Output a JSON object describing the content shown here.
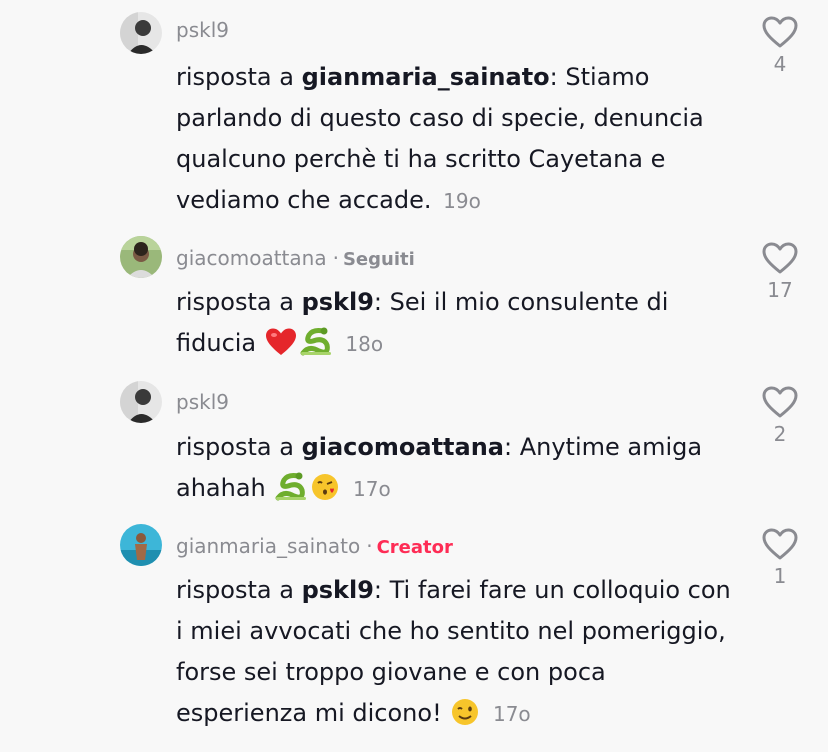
{
  "comments": [
    {
      "username": "pskl9",
      "badge": "",
      "reply_prefix": "risposta a",
      "reply_target": "gianmaria_sainato",
      "text": ": Stiamo parlando di questo caso di specie, denuncia qualcuno perchè ti ha scritto Cayetana e vediamo che accade.",
      "time": "19o",
      "likes": "4",
      "avatar_color": "#555555"
    },
    {
      "username": "giacomoattana",
      "badge": "Seguiti",
      "reply_prefix": "risposta a",
      "reply_target": "pskl9",
      "text": ": Sei il mio consulente di fiducia",
      "emojis": [
        "red-heart-emoji",
        "snake-emoji"
      ],
      "time": "18o",
      "likes": "17",
      "avatar_color": "#6b8f4e"
    },
    {
      "username": "pskl9",
      "badge": "",
      "reply_prefix": "risposta a",
      "reply_target": "giacomoattana",
      "text": ": Anytime amiga ahahah",
      "emojis": [
        "snake-emoji",
        "kiss-emoji"
      ],
      "time": "17o",
      "likes": "2",
      "avatar_color": "#555555"
    },
    {
      "username": "gianmaria_sainato",
      "badge": "Creator",
      "reply_prefix": "risposta a",
      "reply_target": "pskl9",
      "text": ": Ti farei fare un colloquio con i miei avvocati che ho sentito nel pomeriggio, forse sei troppo giovane e con poca esperienza mi dicono!",
      "emojis": [
        "wink-emoji"
      ],
      "time": "17o",
      "likes": "1",
      "avatar_color": "#2fa6c8"
    }
  ],
  "colors": {
    "background": "#f8f8f8",
    "text": "#161823",
    "muted": "#8a8b91",
    "creator_accent": "#fe2c55"
  }
}
